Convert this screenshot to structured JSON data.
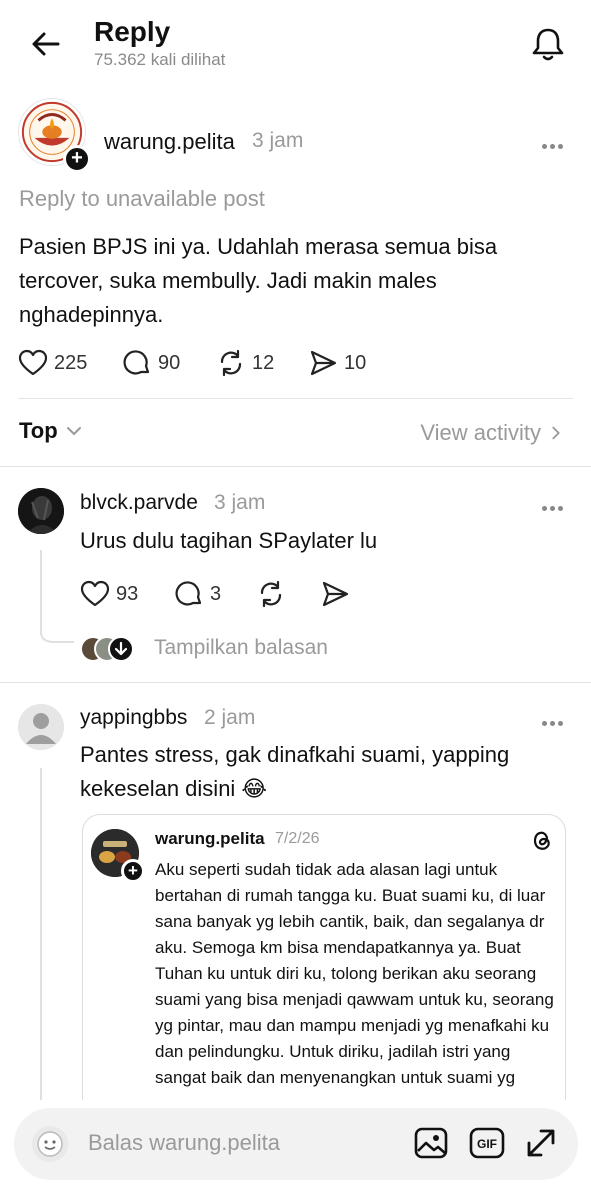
{
  "header": {
    "title": "Reply",
    "views": "75.362 kali dilihat"
  },
  "post": {
    "username": "warung.pelita",
    "time": "3 jam",
    "reply_note": "Reply to unavailable post",
    "body": "Pasien BPJS ini ya. Udahlah merasa semua bisa tercover, suka membully. Jadi makin males nghadepinnya.",
    "avatar_logo_text": "SAMBAL PELITA",
    "likes": "225",
    "comments": "90",
    "reposts": "12",
    "shares": "10"
  },
  "sort": {
    "label": "Top",
    "view_activity": "View activity"
  },
  "replies": [
    {
      "username": "blvck.parvde",
      "time": "3 jam",
      "text": "Urus dulu tagihan SPaylater lu",
      "likes": "93",
      "comments": "3",
      "show_replies": "Tampilkan balasan"
    },
    {
      "username": "yappingbbs",
      "time": "2 jam",
      "text": "Pantes stress, gak dinafkahi suami, yapping kekeselan disini 😂",
      "quote": {
        "username": "warung.pelita",
        "time": "7/2/26",
        "body": "Aku seperti sudah tidak ada alasan lagi untuk bertahan di rumah tangga ku. Buat suami ku, di luar sana banyak yg lebih cantik, baik, dan segalanya dr aku. Semoga km bisa mendapatkannya ya. Buat Tuhan ku untuk diri ku, tolong berikan aku seorang suami yang bisa menjadi qawwam untuk ku, seorang yg pintar, mau dan mampu menjadi yg menafkahi ku dan pelindungku. Untuk diriku, jadilah istri yang sangat baik dan menyenangkan untuk suami yg"
      }
    }
  ],
  "composer": {
    "placeholder": "Balas warung.pelita",
    "gif_label": "GIF"
  },
  "icons": {
    "back": "arrow-left-icon",
    "bell": "bell-icon",
    "heart": "heart-icon",
    "comment": "comment-icon",
    "repost": "repost-icon",
    "share": "send-icon",
    "more": "more-dots-icon",
    "threads": "threads-icon",
    "image": "image-icon",
    "gif": "gif-icon",
    "expand": "expand-icon"
  },
  "colors": {
    "text": "#111111",
    "muted": "#9a9a9a",
    "divider": "#e3e3e3",
    "logo_red": "#c0392b",
    "logo_orange": "#e67e22"
  }
}
